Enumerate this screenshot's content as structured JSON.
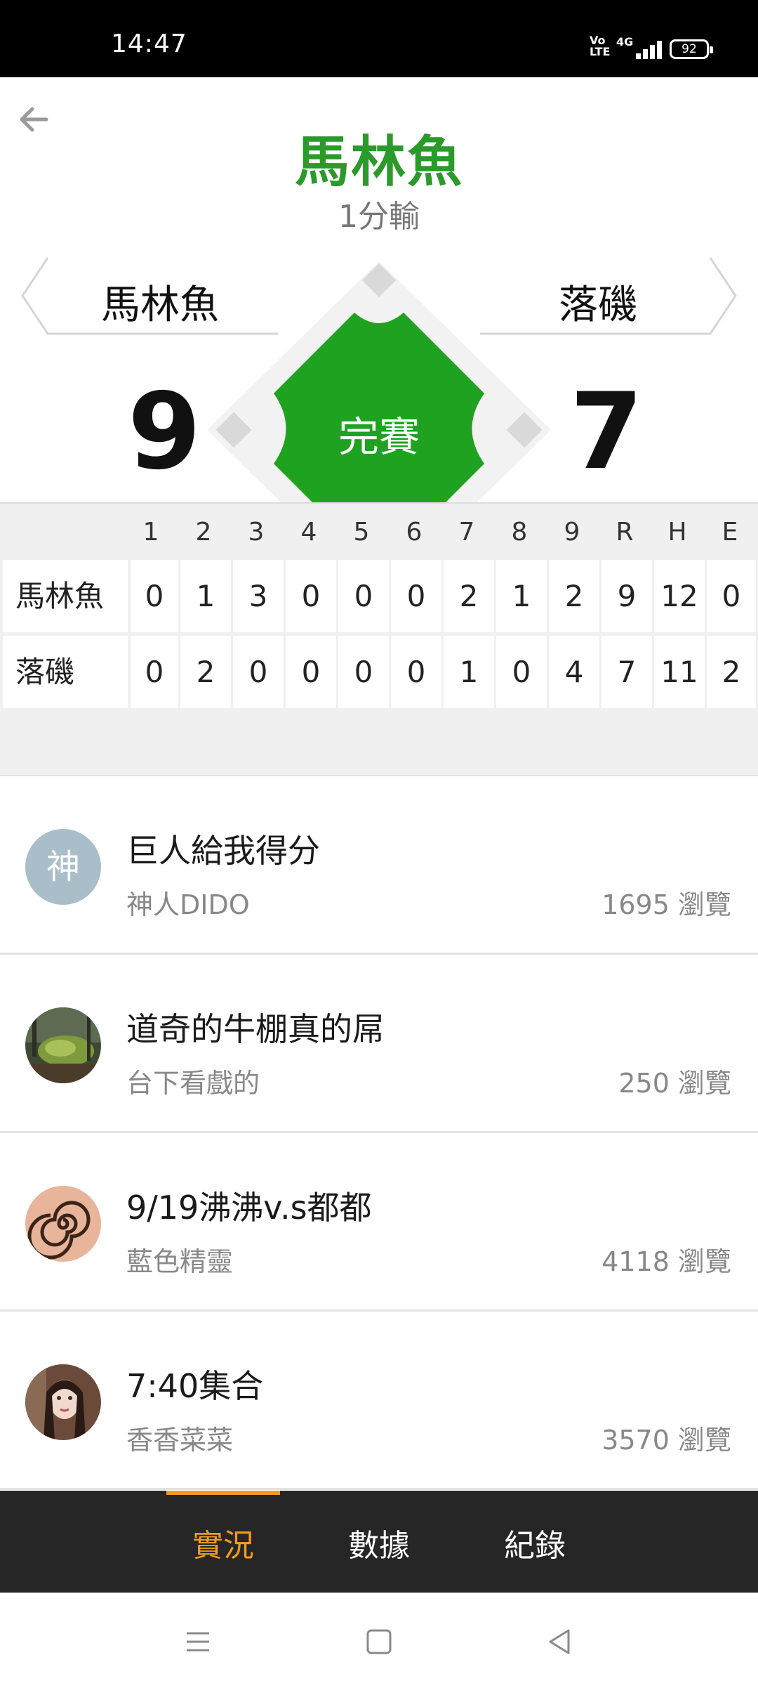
{
  "status_bar": {
    "time": "14:47",
    "volte": "Vo LTE",
    "network": "4G",
    "battery": "92"
  },
  "header": {
    "title": "馬林魚",
    "subtitle": "1分輸"
  },
  "game": {
    "home_team": "馬林魚",
    "away_team": "落磯",
    "home_score": "9",
    "away_score": "7",
    "status": "完賽"
  },
  "linescore": {
    "columns": [
      "1",
      "2",
      "3",
      "4",
      "5",
      "6",
      "7",
      "8",
      "9",
      "R",
      "H",
      "E"
    ],
    "rows": [
      {
        "team": "馬林魚",
        "values": [
          "0",
          "1",
          "3",
          "0",
          "0",
          "0",
          "2",
          "1",
          "2",
          "9",
          "12",
          "0"
        ]
      },
      {
        "team": "落磯",
        "values": [
          "0",
          "2",
          "0",
          "0",
          "0",
          "0",
          "1",
          "0",
          "4",
          "7",
          "11",
          "2"
        ]
      }
    ]
  },
  "posts": [
    {
      "title": "巨人給我得分",
      "author": "神人DIDO",
      "views": "1695 瀏覽",
      "avatar_letter": "神",
      "avatar": "letter-avatar"
    },
    {
      "title": "道奇的牛棚真的屌",
      "author": "台下看戲的",
      "views": "250 瀏覽",
      "avatar": "forest-photo-avatar"
    },
    {
      "title": "9/19沸沸v.s都都",
      "author": "藍色精靈",
      "views": "4118 瀏覽",
      "avatar": "spiral-avatar"
    },
    {
      "title": "7:40集合",
      "author": "香香菜菜",
      "views": "3570 瀏覽",
      "avatar": "portrait-photo-avatar"
    }
  ],
  "tabs": [
    {
      "label": "實況",
      "active": true
    },
    {
      "label": "數據",
      "active": false
    },
    {
      "label": "紀錄",
      "active": false
    }
  ],
  "colors": {
    "accent_green": "#2a9a2a",
    "diamond_green": "#1fa21f",
    "tab_active": "#f39a1e",
    "tab_bar_bg": "#262626"
  }
}
